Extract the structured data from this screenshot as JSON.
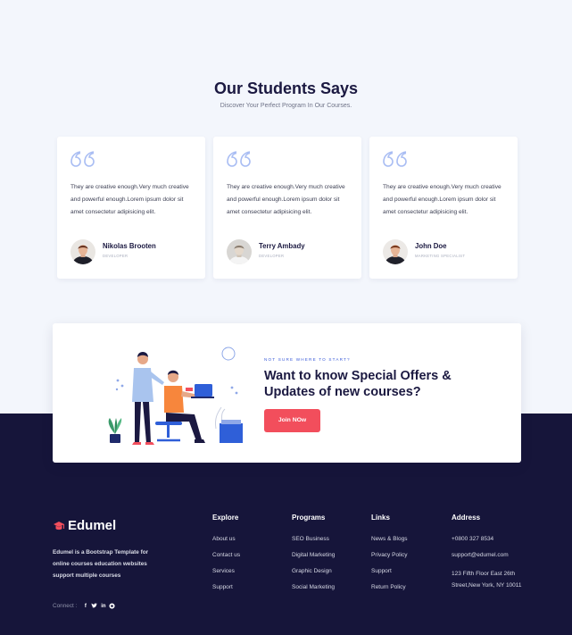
{
  "testimonials": {
    "title": "Our Students Says",
    "subtitle": "Discover Your Perfect Program In Our Courses.",
    "cards": [
      {
        "text": "They are creative enough.Very much creative and powerful enough.Lorem ipsum dolor sit amet consectetur adipisicing elit.",
        "name": "Nikolas Brooten",
        "role": "Developer"
      },
      {
        "text": "They are creative enough.Very much creative and powerful enough.Lorem ipsum dolor sit amet consectetur adipisicing elit.",
        "name": "Terry Ambady",
        "role": "Developer"
      },
      {
        "text": "They are creative enough.Very much creative and powerful enough.Lorem ipsum dolor sit amet consectetur adipisicing elit.",
        "name": "John Doe",
        "role": "Marketing Specialist"
      }
    ]
  },
  "cta": {
    "eyebrow": "Not sure where to start?",
    "heading": "Want to know Special Offers & Updates of new courses?",
    "button": "Join NOw"
  },
  "footer": {
    "brand": "Edumel",
    "description": "Edumel is a Bootstrap Template for online courses education websites support multiple courses",
    "connect_label": "Connect :",
    "social_icons": [
      "facebook-icon",
      "twitter-icon",
      "linkedin-icon",
      "instagram-icon"
    ],
    "columns": [
      {
        "title": "Explore",
        "items": [
          "About us",
          "Contact us",
          "Services",
          "Support"
        ]
      },
      {
        "title": "Programs",
        "items": [
          "SEO Business",
          "Digital Marketing",
          "Graphic Design",
          "Social Marketing"
        ]
      },
      {
        "title": "Links",
        "items": [
          "News & Blogs",
          "Privacy Policy",
          "Support",
          "Return Policy"
        ]
      }
    ],
    "address": {
      "title": "Address",
      "phone": "+0800 327 8534",
      "email": "support@edumel.com",
      "location": "123 Fifth Floor East 26th Street,New York, NY 10011"
    }
  },
  "colors": {
    "accent": "#f24e5c",
    "navy": "#16153a",
    "quote": "#a9bdf3",
    "eyebrow": "#3a5bd9"
  }
}
